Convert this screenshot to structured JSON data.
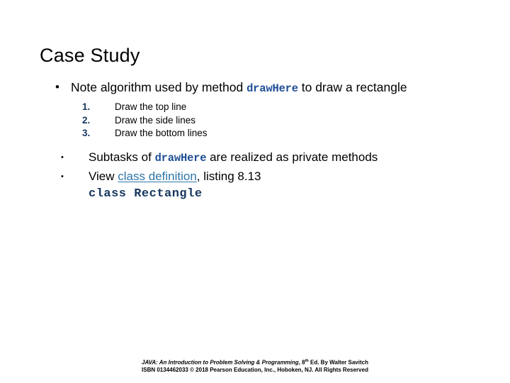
{
  "slide": {
    "title": "Case Study",
    "bullets": {
      "level1": {
        "marker": "•",
        "text_before_code": "Note algorithm used by method ",
        "code": "drawHere",
        "text_after_code": " to draw a rectangle"
      },
      "numbered": [
        {
          "number": "1.",
          "text": "Draw the top line"
        },
        {
          "number": "2.",
          "text": "Draw the side lines"
        },
        {
          "number": "3.",
          "text": "Draw the bottom lines"
        }
      ],
      "level2": [
        {
          "marker": "•",
          "text_before_code": "Subtasks of ",
          "code": "drawHere",
          "text_after_code": " are realized as private methods"
        },
        {
          "marker": "•",
          "text_before_link": "View ",
          "link_text": "class definition",
          "text_after_link": ", listing 8.13"
        }
      ],
      "code_block": "class Rectangle"
    }
  },
  "footer": {
    "line1_title": "JAVA: An Introduction to Problem  Solving & Programming",
    "line1_rest_prefix": ", 8",
    "line1_superscript": "th",
    "line1_rest_suffix": " Ed. By Walter Savitch",
    "line2": "ISBN 0134462033  © 2018 Pearson Education, Inc., Hoboken, NJ. All Rights Reserved"
  },
  "colors": {
    "code_blue": "#1F4E96",
    "code_block_blue": "#17375E",
    "hyperlink_blue": "#2E75A8",
    "number_blue": "#17375E",
    "background": "#FFFFFF",
    "text": "#000000"
  }
}
